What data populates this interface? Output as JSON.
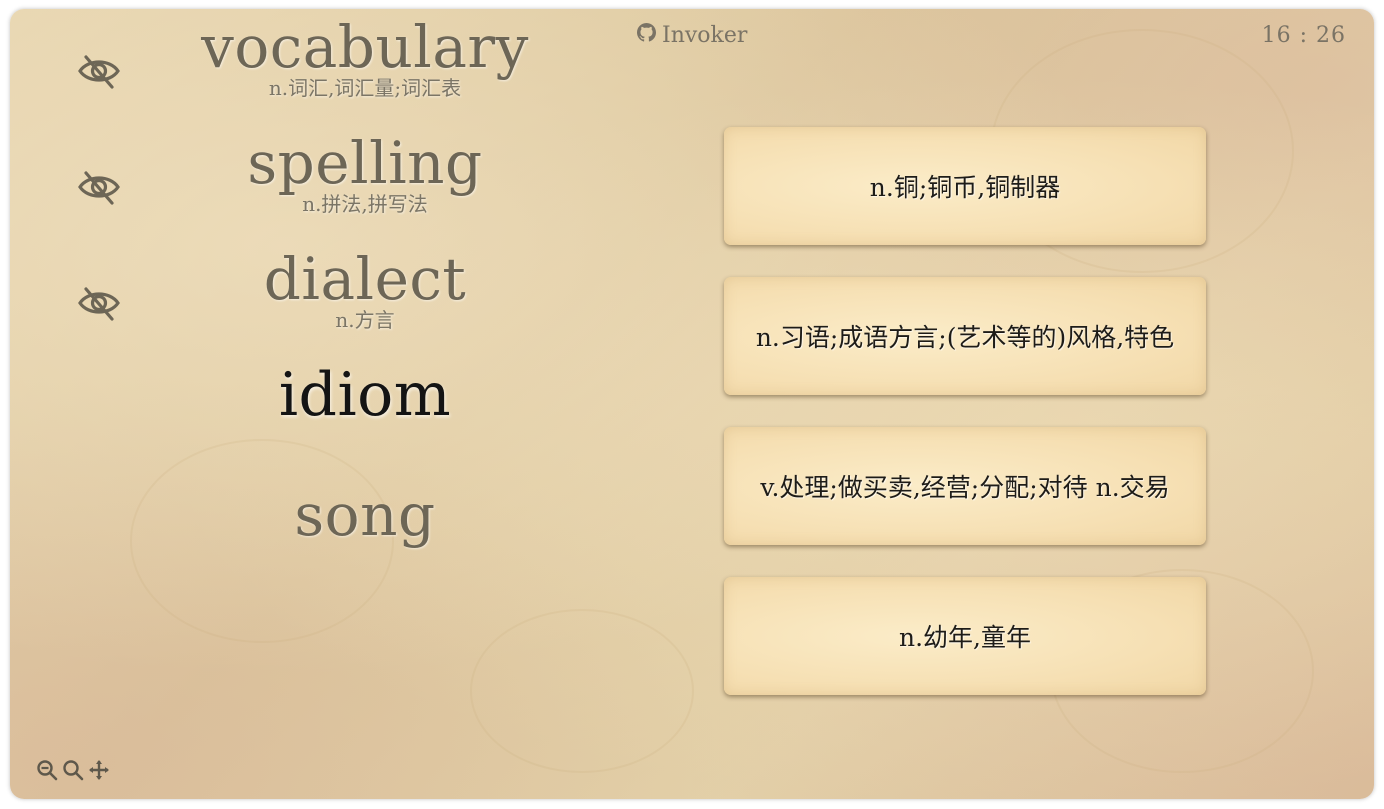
{
  "header": {
    "github_label": "Invoker",
    "clock": "16 : 26"
  },
  "words": [
    {
      "word": "vocabulary",
      "meaning": "n.词汇,词汇量;词汇表",
      "hidden": true
    },
    {
      "word": "spelling",
      "meaning": "n.拼法,拼写法",
      "hidden": true
    },
    {
      "word": "dialect",
      "meaning": "n.方言",
      "hidden": true
    },
    {
      "word": "idiom",
      "meaning": "",
      "active": true
    },
    {
      "word": "song",
      "meaning": ""
    }
  ],
  "options": [
    "n.铜;铜币,铜制器",
    "n.习语;成语方言;(艺术等的)风格,特色",
    "v.处理;做买卖,经营;分配;对待 n.交易",
    "n.幼年,童年"
  ],
  "icons": {
    "eye": "eye-slash-icon",
    "github": "github-icon",
    "zoom_out": "zoom-out-icon",
    "zoom_in": "zoom-in-icon",
    "move": "move-icon"
  },
  "colors": {
    "text_muted": "#6d6656",
    "text_active": "#141414",
    "card_bg": "#f6e0b4"
  }
}
